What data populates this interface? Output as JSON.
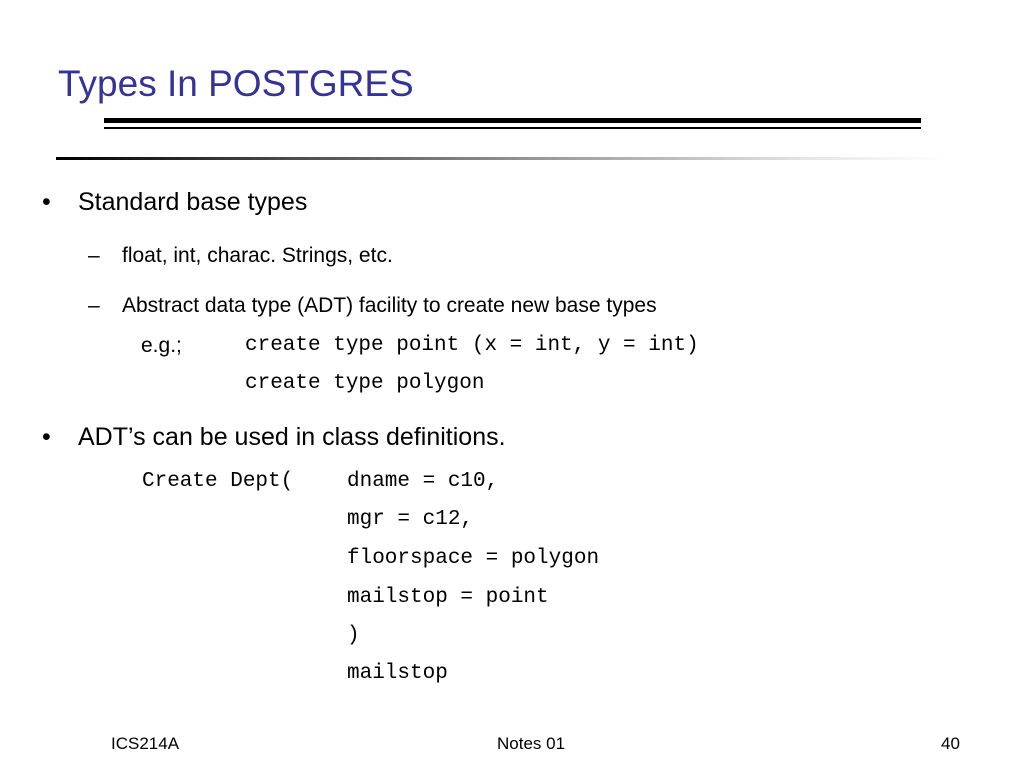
{
  "slide": {
    "title": "Types In POSTGRES",
    "bullets": [
      {
        "marker": "•",
        "text": "Standard base types",
        "sub": [
          {
            "marker": "–",
            "text": "float, int, charac. Strings, etc."
          },
          {
            "marker": "–",
            "text": "Abstract data type (ADT) facility to create new base types"
          }
        ]
      },
      {
        "marker": "•",
        "text": "ADT’s can be used in class definitions."
      }
    ],
    "example_label": "e.g.;",
    "example_code": [
      "create type point (x = int, y = int)",
      "create type polygon"
    ],
    "class_code": {
      "prefix": "Create Dept(",
      "lines": [
        "dname = c10,",
        "mgr = c12,",
        "floorspace = polygon",
        "mailstop = point",
        ")",
        "mailstop"
      ]
    }
  },
  "footer": {
    "left": "ICS214A",
    "center": "Notes 01",
    "page": "40"
  },
  "colors": {
    "title": "#333399",
    "text": "#000000",
    "background": "#ffffff"
  }
}
